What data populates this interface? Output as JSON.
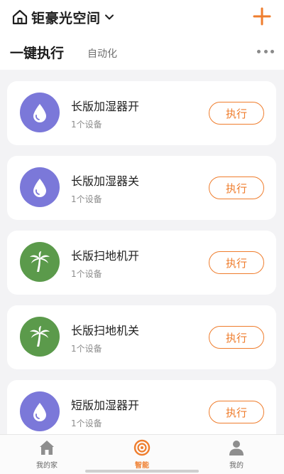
{
  "header": {
    "home_title": "钜豪光空间",
    "home_icon": "home-outline-icon",
    "dropdown_icon": "chevron-down-icon",
    "add_icon": "plus-icon"
  },
  "tabs": {
    "active": "一键执行",
    "inactive": "自动化",
    "more_icon": "more-dots-icon"
  },
  "scenes": [
    {
      "name": "长版加湿器开",
      "sub": "1个设备",
      "icon": "water-drop-icon",
      "button": "执行"
    },
    {
      "name": "长版加湿器关",
      "sub": "1个设备",
      "icon": "water-drop-icon",
      "button": "执行"
    },
    {
      "name": "长版扫地机开",
      "sub": "1个设备",
      "icon": "palm-tree-icon",
      "button": "执行"
    },
    {
      "name": "长版扫地机关",
      "sub": "1个设备",
      "icon": "palm-tree-icon",
      "button": "执行"
    },
    {
      "name": "短版加湿器开",
      "sub": "1个设备",
      "icon": "water-drop-icon",
      "button": "执行"
    }
  ],
  "bottom_nav": {
    "items": [
      {
        "label": "我的家",
        "icon": "house-icon"
      },
      {
        "label": "智能",
        "icon": "smart-target-icon"
      },
      {
        "label": "我的",
        "icon": "person-icon"
      }
    ],
    "active_index": 1
  },
  "colors": {
    "accent": "#ef7d2d",
    "purple_icon_bg": "#7b78d9",
    "green_icon_bg": "#5b9a4b",
    "background": "#f3f3f5"
  }
}
